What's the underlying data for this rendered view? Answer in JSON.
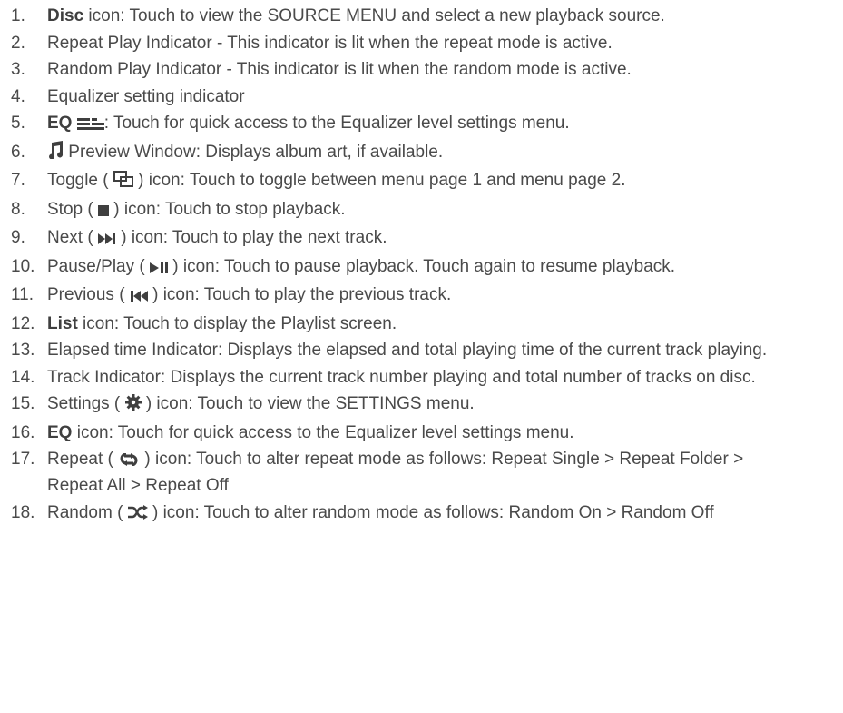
{
  "items": [
    {
      "num": "1.",
      "bold": "Disc",
      "parts": [
        " icon: Touch to view the SOURCE MENU and select a new playback source."
      ]
    },
    {
      "num": "2.",
      "parts": [
        "Repeat Play Indicator - This indicator is lit when the repeat mode is active."
      ]
    },
    {
      "num": "3.",
      "parts": [
        "Random Play Indicator - This indicator is lit when the random mode is active."
      ]
    },
    {
      "num": "4.",
      "parts": [
        "Equalizer setting indicator"
      ]
    },
    {
      "num": "5.",
      "bold": "EQ",
      "icon": "eq-bars-icon",
      "parts": [
        ": Touch for quick access to the Equalizer level settings menu."
      ]
    },
    {
      "num": "6.",
      "icon": "music-note-icon",
      "parts": [
        " Preview Window: Displays album art, if available."
      ]
    },
    {
      "num": "7.",
      "pre": "Toggle ( ",
      "icon": "toggle-pages-icon",
      "parts": [
        " ) icon: Touch to toggle between menu page 1 and menu page 2."
      ]
    },
    {
      "num": "8.",
      "pre": "Stop ( ",
      "icon": "stop-icon",
      "parts": [
        " ) icon: Touch to stop playback."
      ]
    },
    {
      "num": "9.",
      "pre": "Next ( ",
      "icon": "next-icon",
      "parts": [
        " ) icon: Touch to play the next track."
      ]
    },
    {
      "num": "10.",
      "pre": "Pause/Play ( ",
      "icon": "play-pause-icon",
      "parts": [
        " ) icon: Touch to pause playback. Touch again to resume playback."
      ]
    },
    {
      "num": "11.",
      "pre": "Previous ( ",
      "icon": "previous-icon",
      "parts": [
        " ) icon: Touch to play the previous track."
      ]
    },
    {
      "num": "12.",
      "bold": "List",
      "parts": [
        " icon: Touch to display the Playlist screen."
      ]
    },
    {
      "num": "13.",
      "parts": [
        "Elapsed time Indicator: Displays the elapsed and total playing time of the current track playing."
      ]
    },
    {
      "num": "14.",
      "parts": [
        "Track Indicator: Displays the current track number playing and total number of tracks on disc."
      ]
    },
    {
      "num": "15.",
      "pre": "Settings ( ",
      "icon": "gear-icon",
      "parts": [
        " ) icon: Touch to view the SETTINGS menu."
      ]
    },
    {
      "num": "16.",
      "bold": "EQ",
      "parts": [
        " icon: Touch for quick access to the Equalizer level settings menu."
      ]
    },
    {
      "num": "17.",
      "pre": "Repeat ( ",
      "icon": "repeat-icon",
      "parts": [
        " ) icon: Touch to alter repeat mode as follows: Repeat Single > Repeat Folder > Repeat All > Repeat Off"
      ]
    },
    {
      "num": "18.",
      "pre": "Random ( ",
      "icon": "shuffle-icon",
      "parts": [
        " ) icon: Touch to alter random mode as follows: Random On > Random Off"
      ]
    }
  ]
}
